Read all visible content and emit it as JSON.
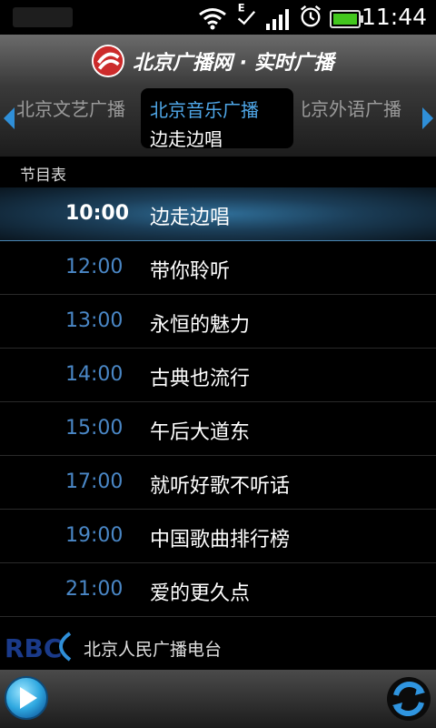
{
  "status_bar": {
    "time": "11:44",
    "icons": [
      "wifi-icon",
      "data-e-icon",
      "signal-icon",
      "alarm-icon",
      "battery-icon"
    ],
    "data_indicator": "E"
  },
  "header": {
    "title": "北京广播网 · 实时广播",
    "logo_icon": "broadcast-logo-icon",
    "brand_color": "#cc2b2b"
  },
  "channels": {
    "left": "北京文艺广播",
    "active": {
      "name": "北京音乐广播",
      "program": "边走边唱"
    },
    "right": "北京外语广播"
  },
  "schedule": {
    "label": "节目表",
    "rows": [
      {
        "time": "10:00",
        "program": "边走边唱",
        "current": true
      },
      {
        "time": "12:00",
        "program": "带你聆听",
        "current": false
      },
      {
        "time": "13:00",
        "program": "永恒的魅力",
        "current": false
      },
      {
        "time": "14:00",
        "program": "古典也流行",
        "current": false
      },
      {
        "time": "15:00",
        "program": "午后大道东",
        "current": false
      },
      {
        "time": "17:00",
        "program": "就听好歌不听话",
        "current": false
      },
      {
        "time": "19:00",
        "program": "中国歌曲排行榜",
        "current": false
      },
      {
        "time": "21:00",
        "program": "爱的更久点",
        "current": false
      }
    ]
  },
  "station": {
    "logo_text": "RBC",
    "name": "北京人民广播电台"
  },
  "colors": {
    "accent": "#4fa7e8",
    "time_text": "#4a87c6"
  }
}
